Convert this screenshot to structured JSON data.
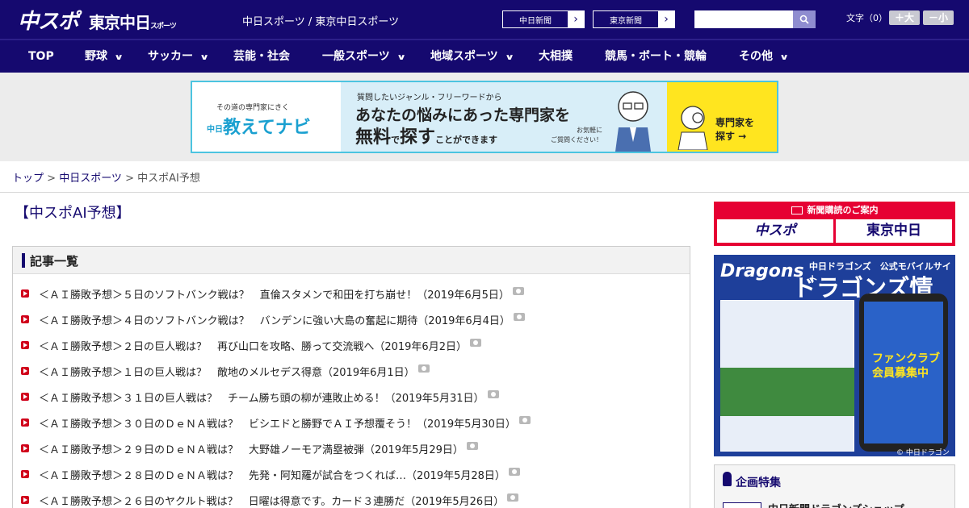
{
  "header": {
    "logo_chunichi_sports": "中スポ",
    "logo_tokyo_chunichi": "東京中日",
    "logo_tokyo_suffix": "スポーツ",
    "tagline": "中日スポーツ / 東京中日スポーツ",
    "ext_links": [
      {
        "label": "中日新聞",
        "arrow": "›"
      },
      {
        "label": "東京新聞",
        "arrow": "›"
      }
    ],
    "search_placeholder": "",
    "fontsize_label": "文字（0）",
    "fontsize_larger": "＋大",
    "fontsize_smaller": "－小"
  },
  "nav": {
    "items": [
      {
        "label": "TOP",
        "has_dropdown": false
      },
      {
        "label": "野球",
        "has_dropdown": true
      },
      {
        "label": "サッカー",
        "has_dropdown": true
      },
      {
        "label": "芸能・社会",
        "has_dropdown": false
      },
      {
        "label": "一般スポーツ",
        "has_dropdown": true
      },
      {
        "label": "地域スポーツ",
        "has_dropdown": true
      },
      {
        "label": "大相撲",
        "has_dropdown": false
      },
      {
        "label": "競馬・ボート・競輪",
        "has_dropdown": false
      },
      {
        "label": "その他",
        "has_dropdown": true
      }
    ],
    "chevron": "∨"
  },
  "banner": {
    "small_text": "その道の専門家にきく",
    "brand": "教えてナビ",
    "brand_prefix": "中日",
    "line1": "質問したいジャンル・フリーワードから",
    "line2": "あなたの悩みにあった専門家を",
    "line3_a": "無料",
    "line3_b": "で",
    "line3_c": "探す",
    "line3_d": "ことができます",
    "note": "お気軽に\nご質問ください！",
    "cta": "専門家を\n探す →"
  },
  "breadcrumb": {
    "top": "トップ",
    "section": "中日スポーツ",
    "current": "中スポAI予想",
    "sep": " > "
  },
  "main": {
    "page_title": "【中スポAI予想】",
    "list_heading": "記事一覧",
    "articles": [
      "＜ＡＩ勝敗予想＞５日のソフトバンク戦は？　直倫スタメンで和田を打ち崩せ！（2019年6月5日）",
      "＜ＡＩ勝敗予想＞４日のソフトバンク戦は？　バンデンに強い大島の奮起に期待（2019年6月4日）",
      "＜ＡＩ勝敗予想＞２日の巨人戦は？　再び山口を攻略、勝って交流戦へ（2019年6月2日）",
      "＜ＡＩ勝敗予想＞１日の巨人戦は？　敵地のメルセデス得意（2019年6月1日）",
      "＜ＡＩ勝敗予想＞３１日の巨人戦は？　チーム勝ち頭の柳が連敗止める！（2019年5月31日）",
      "＜ＡＩ勝敗予想＞３０日のＤｅＮＡ戦は？　ビシエドと勝野でＡＩ予想覆そう！（2019年5月30日）",
      "＜ＡＩ勝敗予想＞２９日のＤｅＮＡ戦は？　大野雄ノーモア満塁被弾（2019年5月29日）",
      "＜ＡＩ勝敗予想＞２８日のＤｅＮＡ戦は？　先発・阿知羅が試合をつくれば…（2019年5月28日）",
      "＜ＡＩ勝敗予想＞２６日のヤクルト戦は？　日曜は得意です。カード３連勝だ（2019年5月26日）"
    ]
  },
  "sidebar": {
    "subscribe_title": "新聞購読のご案内",
    "subscribe_chunichi": "中スポ",
    "subscribe_tokyo": "東京中日",
    "dragons_logo": "Dragons",
    "dragons_sub": "中日ドラゴンズ　公式モバイルサイト",
    "dragons_title": "ドラゴンズ情報",
    "dragons_phone_text": "ファンクラブ\n会員募集中",
    "dragons_copyright": "© 中日ドラゴンズ",
    "feature_title": "企画特集",
    "feature_item": "中日新聞ドラゴンズショップ"
  },
  "colors": {
    "brand_navy": "#15096f",
    "subscribe_red": "#e60033",
    "banner_border": "#4cc4e0",
    "bullet_red": "#d0021b"
  }
}
